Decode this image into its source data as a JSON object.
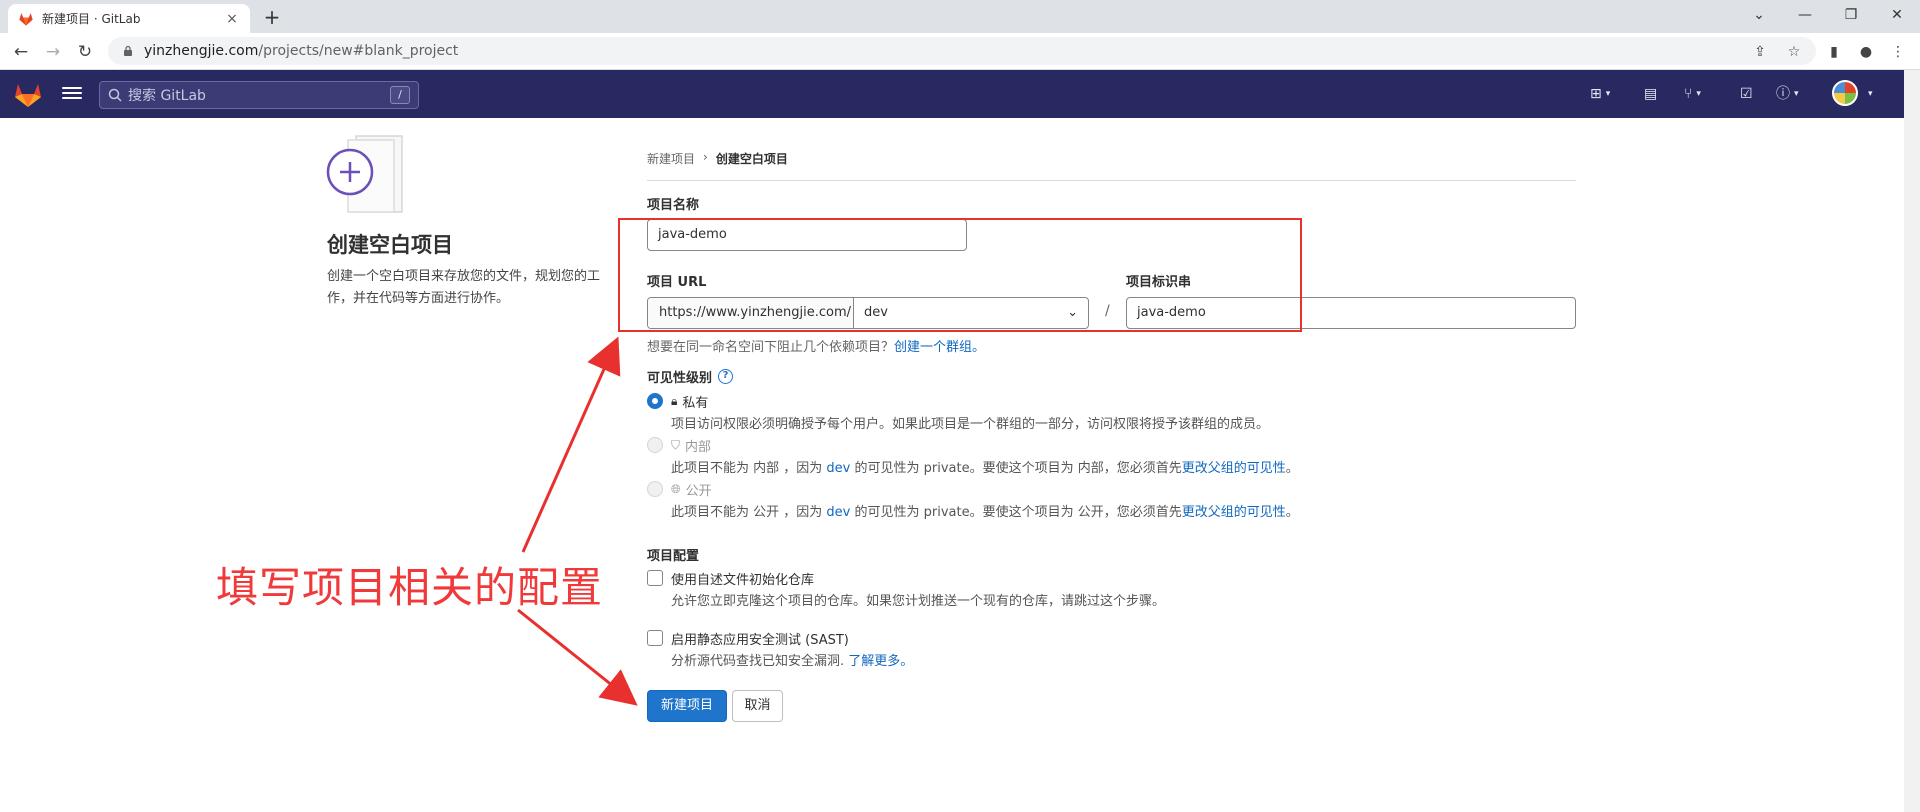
{
  "browser": {
    "tab_title": "新建项目 · GitLab",
    "tab_close": "×",
    "new_tab": "+",
    "url_host": "yinzhengjie.com",
    "url_path": "/projects/new#blank_project"
  },
  "header": {
    "search_placeholder": "搜索 GitLab",
    "search_shortcut": "/"
  },
  "left": {
    "title": "创建空白项目",
    "description": "创建一个空白项目来存放您的文件，规划您的工作，并在代码等方面进行协作。"
  },
  "breadcrumb": {
    "parent": "新建项目",
    "separator": "›",
    "current": "创建空白项目"
  },
  "form": {
    "name_label": "项目名称",
    "name_value": "java-demo",
    "url_label": "项目 URL",
    "url_prefix": "https://www.yinzhengjie.com/",
    "namespace_value": "dev",
    "namespace_caret": "⌄",
    "slash": "/",
    "slug_label": "项目标识串",
    "slug_value": "java-demo",
    "group_hint": "想要在同一命名空间下阻止几个依赖项目？",
    "group_link": "创建一个群组。",
    "visibility_label": "可见性级别",
    "visibility_help": "?",
    "private_label": "私有",
    "private_desc": "项目访问权限必须明确授予每个用户。如果此项目是一个群组的一部分，访问权限将授予该群组的成员。",
    "internal_label": "内部",
    "internal_desc_a": "此项目不能为 内部 ，因为 ",
    "internal_desc_link": "dev",
    "internal_desc_b": " 的可见性为 private。要使这个项目为 内部，您必须首先",
    "internal_desc_link2": "更改父组的可见性",
    "internal_desc_end": "。",
    "public_label": "公开",
    "public_desc_a": "此项目不能为 公开 ，因为 ",
    "public_desc_link": "dev",
    "public_desc_b": " 的可见性为 private。要使这个项目为 公开，您必须首先",
    "public_desc_link2": "更改父组的可见性",
    "public_desc_end": "。",
    "config_label": "项目配置",
    "readme_label": "使用自述文件初始化仓库",
    "readme_desc": "允许您立即克隆这个项目的仓库。如果您计划推送一个现有的仓库，请跳过这个步骤。",
    "sast_label": "启用静态应用安全测试 (SAST)",
    "sast_desc": "分析源代码查找已知安全漏洞.",
    "sast_link": "了解更多。",
    "create_button": "新建项目",
    "cancel_button": "取消"
  },
  "annotation": {
    "text": "填写项目相关的配置",
    "color": "#f0393a"
  },
  "colors": {
    "header_bg": "#292961",
    "primary": "#1f75cb",
    "link": "#1068bf"
  }
}
